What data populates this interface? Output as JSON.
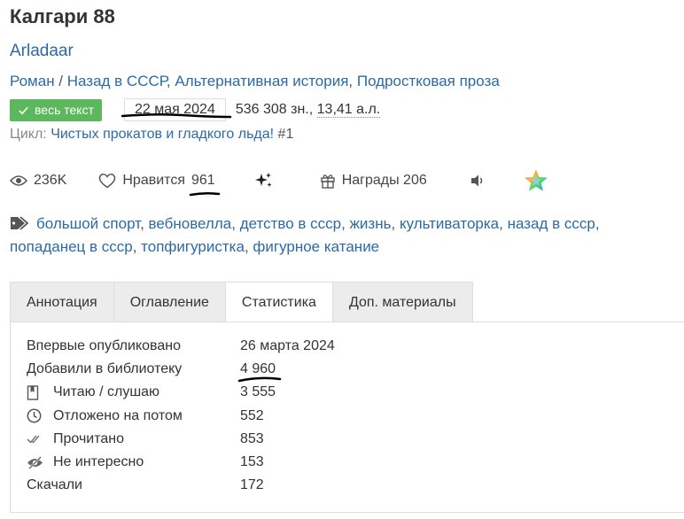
{
  "book": {
    "title": "Калгари 88",
    "author": "Arladaar",
    "genres": [
      "Роман",
      "Назад в СССР",
      "Альтернативная история",
      "Подростковая проза"
    ],
    "genre_sep_1": " / ",
    "genre_sep": ", ",
    "fulltext_label": "весь текст",
    "date": "22 мая 2024",
    "size_chars": "536 308 зн., ",
    "size_sheets": "13,41 а.л.",
    "cycle_label": "Цикл: ",
    "cycle_name": "Чистых прокатов и гладкого льда!",
    "cycle_number": " #1"
  },
  "stats": {
    "views": "236K",
    "likes_label": "Нравится",
    "likes_count": "961",
    "awards_label": "Награды 206"
  },
  "tags": [
    "большой спорт",
    "вебновелла",
    "детство в ссср",
    "жизнь",
    "культиваторка",
    "назад в ссср",
    "попаданец в ссср",
    "топфигуристка",
    "фигурное катание"
  ],
  "tabs": [
    "Аннотация",
    "Оглавление",
    "Статистика",
    "Доп. материалы"
  ],
  "active_tab": "Статистика",
  "statistics": [
    {
      "label": "Впервые опубликовано",
      "value": "26 марта 2024",
      "icon": ""
    },
    {
      "label": "Добавили в библиотеку",
      "value": "4 960",
      "icon": ""
    },
    {
      "label": "Читаю / слушаю",
      "value": "3 555",
      "icon": "book-icon"
    },
    {
      "label": "Отложено на потом",
      "value": "552",
      "icon": "clock-icon"
    },
    {
      "label": "Прочитано",
      "value": "853",
      "icon": "double-check-icon"
    },
    {
      "label": "Не интересно",
      "value": "153",
      "icon": "eye-slash-icon"
    },
    {
      "label": "Скачали",
      "value": "172",
      "icon": ""
    }
  ],
  "colors": {
    "link": "#2c6aa6",
    "badge_green": "#5cb85c",
    "tab_inactive": "#ececec",
    "border": "#dddddd"
  }
}
